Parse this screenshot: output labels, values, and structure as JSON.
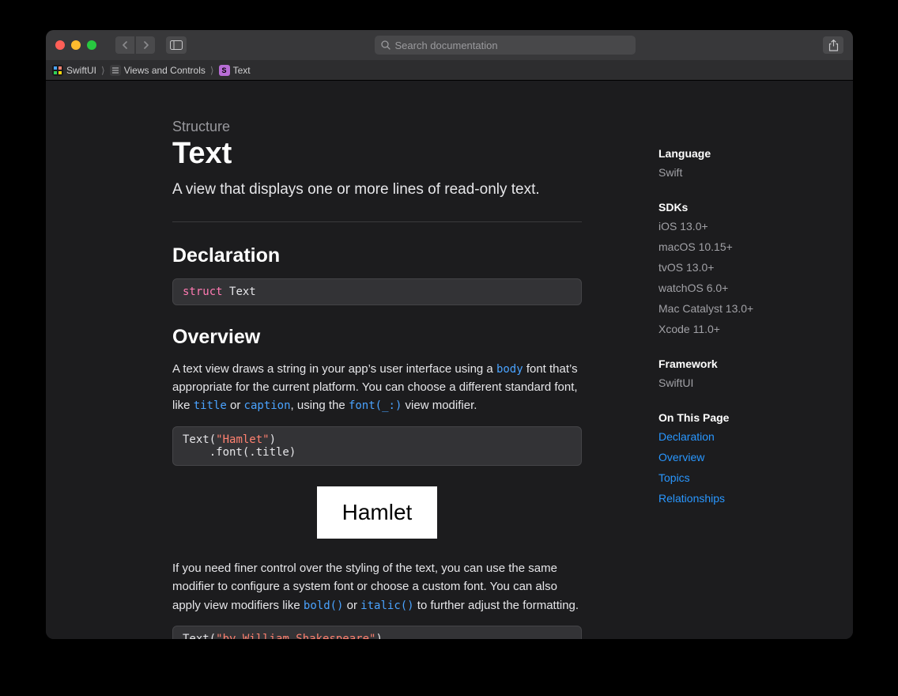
{
  "search": {
    "placeholder": "Search documentation"
  },
  "breadcrumb": [
    {
      "label": "SwiftUI"
    },
    {
      "label": "Views and Controls"
    },
    {
      "label": "Text"
    }
  ],
  "doc": {
    "eyebrow": "Structure",
    "title": "Text",
    "summary": "A view that displays one or more lines of read-only text.",
    "declaration_heading": "Declaration",
    "declaration_keyword": "struct",
    "declaration_name": "Text",
    "overview_heading": "Overview",
    "overview_p1_a": "A text view draws a string in your app’s user interface using a ",
    "overview_link_body": "body",
    "overview_p1_b": " font that’s appropriate for the current platform. You can choose a different standard font, like ",
    "overview_link_title": "title",
    "overview_p1_c": " or ",
    "overview_link_caption": "caption",
    "overview_p1_d": ", using the ",
    "overview_link_font": "font(_:)",
    "overview_p1_e": " view modifier.",
    "code1_a": "Text(",
    "code1_str": "\"Hamlet\"",
    "code1_b": ")\n    .font(.title)",
    "preview_text": "Hamlet",
    "overview_p2_a": "If you need finer control over the styling of the text, you can use the same modifier to configure a system font or choose a custom font. You can also apply view modifiers like ",
    "overview_link_bold": "bold()",
    "overview_p2_b": " or ",
    "overview_link_italic": "italic()",
    "overview_p2_c": " to further adjust the formatting.",
    "code2_a": "Text(",
    "code2_str": "\"by William Shakespeare\"",
    "code2_b": ")"
  },
  "sidebar": {
    "language_h": "Language",
    "language_v": "Swift",
    "sdks_h": "SDKs",
    "sdks": [
      "iOS 13.0+",
      "macOS 10.15+",
      "tvOS 13.0+",
      "watchOS 6.0+",
      "Mac Catalyst 13.0+",
      "Xcode 11.0+"
    ],
    "framework_h": "Framework",
    "framework_v": "SwiftUI",
    "otp_h": "On This Page",
    "otp": [
      "Declaration",
      "Overview",
      "Topics",
      "Relationships"
    ]
  }
}
